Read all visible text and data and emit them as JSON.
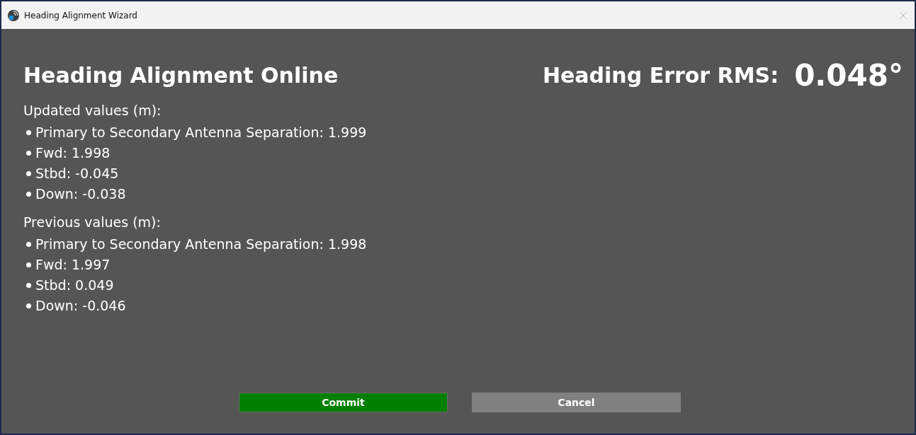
{
  "window": {
    "title": "Heading Alignment Wizard"
  },
  "heading": "Heading Alignment Online",
  "rms": {
    "label": "Heading Error RMS:",
    "value": "0.048°"
  },
  "sections": [
    {
      "title": "Updated values (m):",
      "items": [
        "Primary to Secondary Antenna Separation: 1.999",
        "Fwd: 1.998",
        "Stbd: -0.045",
        "Down: -0.038"
      ]
    },
    {
      "title": "Previous values (m):",
      "items": [
        "Primary to Secondary Antenna Separation: 1.998",
        "Fwd: 1.997",
        "Stbd: 0.049",
        "Down: -0.046"
      ]
    }
  ],
  "buttons": [
    {
      "label": "Commit",
      "kind": "primary"
    },
    {
      "label": "Cancel",
      "kind": "secondary"
    }
  ]
}
